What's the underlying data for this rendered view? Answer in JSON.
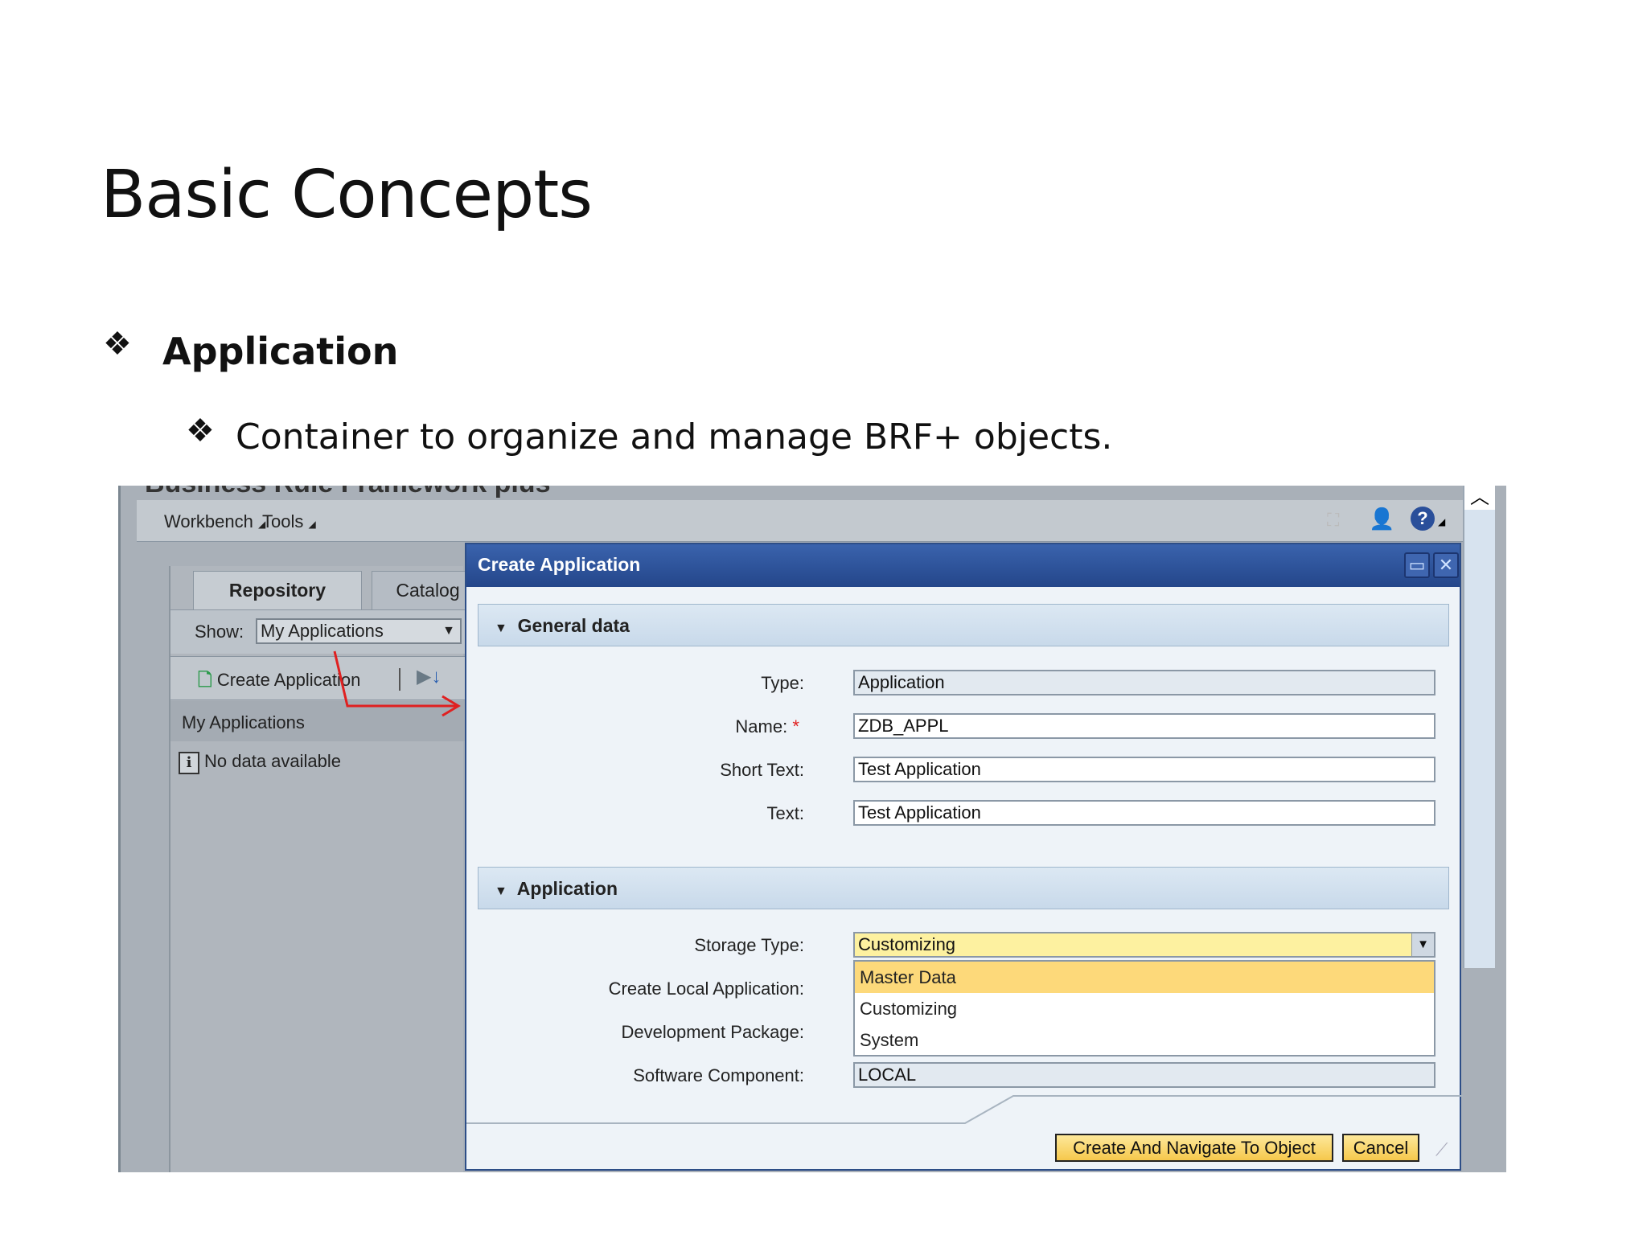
{
  "slide": {
    "title": "Basic Concepts",
    "bullet1": "Application",
    "bullet2": "Container to organize and manage BRF+ objects.",
    "bullet_glyph": "❖"
  },
  "app": {
    "window_title_partial": "Business Rule Framework plus",
    "menu": [
      "Workbench",
      "Tools"
    ],
    "left": {
      "tabs": [
        "Repository",
        "Catalog"
      ],
      "show_label": "Show:",
      "show_value": "My Applications",
      "create_label": "Create Application",
      "list_header": "My Applications",
      "empty_text": "No data available"
    },
    "dialog": {
      "title": "Create Application",
      "section1": "General data",
      "fields1": [
        {
          "label": "Type:",
          "value": "Application"
        },
        {
          "label": "Name:",
          "value": "ZDB_APPL",
          "required": "*"
        },
        {
          "label": "Short Text:",
          "value": "Test Application"
        },
        {
          "label": "Text:",
          "value": "Test Application"
        }
      ],
      "section2": "Application",
      "fields2": {
        "storage_label": "Storage Type:",
        "storage_value": "Customizing",
        "local_label": "Create Local Application:",
        "package_label": "Development Package:",
        "component_label": "Software Component:",
        "component_value": "LOCAL"
      },
      "dropdown_options": [
        "Master Data",
        "Customizing",
        "System"
      ],
      "buttons": {
        "create": "Create And Navigate To Object",
        "cancel": "Cancel"
      }
    },
    "colors": {
      "dialog_header": "#24468a",
      "highlight": "#fdd97a",
      "button": "#f6c84c",
      "arrow": "#e02020"
    }
  }
}
